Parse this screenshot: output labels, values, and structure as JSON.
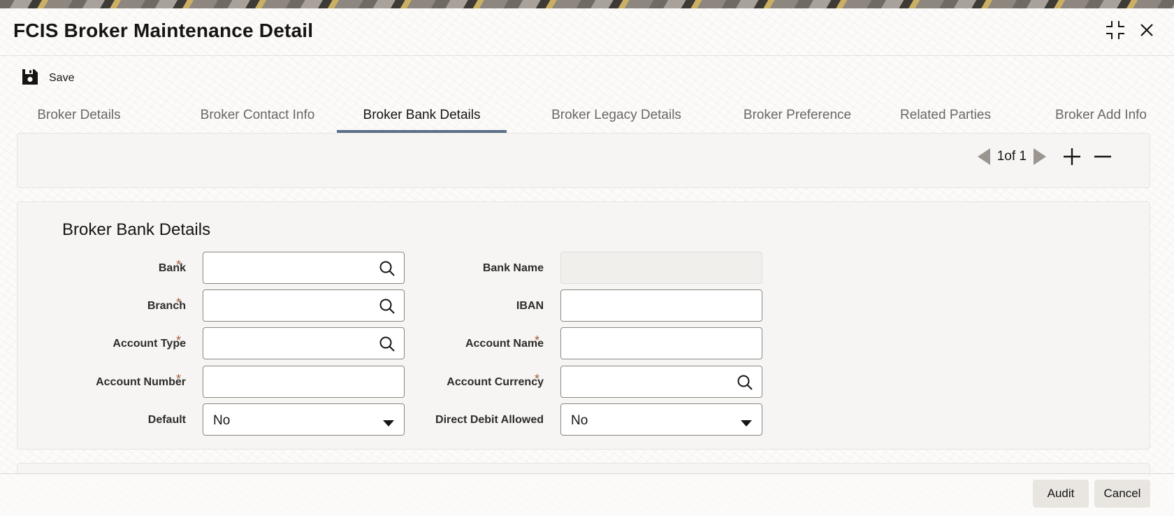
{
  "window": {
    "title": "FCIS Broker Maintenance Detail"
  },
  "toolbar": {
    "save_label": "Save"
  },
  "tabs": [
    {
      "label": "Broker Details"
    },
    {
      "label": "Broker Contact Info"
    },
    {
      "label": "Broker Bank Details",
      "active": true
    },
    {
      "label": "Broker Legacy Details"
    },
    {
      "label": "Broker Preference"
    },
    {
      "label": "Related Parties"
    },
    {
      "label": "Broker Add Info"
    }
  ],
  "pager": {
    "text": "1of 1"
  },
  "section": {
    "title": "Broker Bank Details"
  },
  "fields": {
    "bank": {
      "label": "Bank",
      "required": true,
      "value": ""
    },
    "branch": {
      "label": "Branch",
      "required": true,
      "value": ""
    },
    "account_type": {
      "label": "Account Type",
      "required": true,
      "value": ""
    },
    "account_number": {
      "label": "Account Number",
      "required": true,
      "value": ""
    },
    "default": {
      "label": "Default",
      "required": false,
      "value": "No"
    },
    "bank_name": {
      "label": "Bank Name",
      "required": false,
      "value": ""
    },
    "iban": {
      "label": "IBAN",
      "required": false,
      "value": ""
    },
    "account_name": {
      "label": "Account Name",
      "required": true,
      "value": ""
    },
    "account_currency": {
      "label": "Account Currency",
      "required": true,
      "value": ""
    },
    "direct_debit_allowed": {
      "label": "Direct Debit Allowed",
      "required": false,
      "value": "No"
    }
  },
  "required_marker": "*",
  "footer": {
    "audit_label": "Audit",
    "cancel_label": "Cancel"
  },
  "colors": {
    "active_tab_underline": "#5c6e88",
    "required_marker": "#a05f3c",
    "panel_background": "#f6f5f3"
  }
}
